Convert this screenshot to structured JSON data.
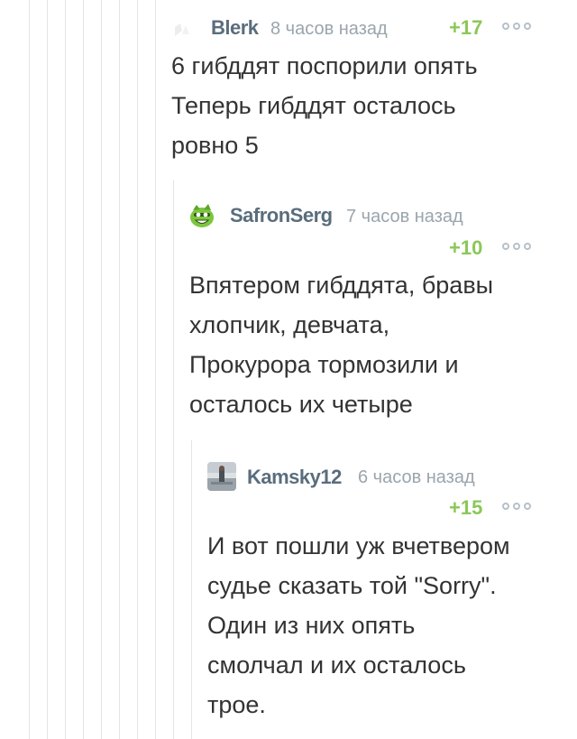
{
  "comments": [
    {
      "author": "Blerk",
      "time": "8 часов назад",
      "rating": "+17",
      "avatar_icon": "blank-avatar-icon",
      "lines": [
        "6 гибддят поспорили опять",
        "Теперь гибддят осталось",
        "ровно 5"
      ]
    },
    {
      "author": "SafronSerg",
      "time": "7 часов назад",
      "rating": "+10",
      "avatar_icon": "green-creature-avatar-icon",
      "lines": [
        "Впятером гибддята, бравы",
        "хлопчик, девчата,",
        "Прокурора тормозили и",
        "осталось их четыре"
      ]
    },
    {
      "author": "Kamsky12",
      "time": "6 часов назад",
      "rating": "+15",
      "avatar_icon": "photo-avatar-icon",
      "lines": [
        "И вот пошли уж вчетвером",
        "судье сказать той \"Sorry\".",
        "Один из них опять",
        "смолчал и их осталось",
        "трое."
      ]
    }
  ],
  "colors": {
    "author": "#5a6d7c",
    "time": "#9aa5ad",
    "rating": "#8ac858",
    "thread_line": "#e4e4e4"
  }
}
